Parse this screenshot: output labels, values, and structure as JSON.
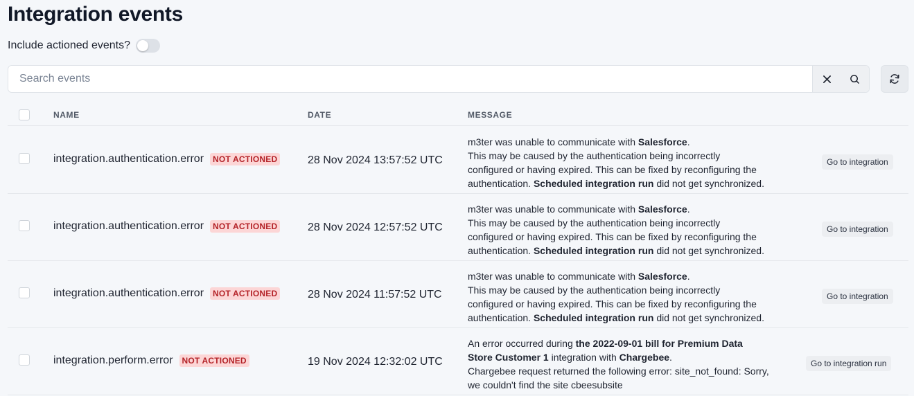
{
  "page": {
    "title": "Integration events"
  },
  "filter": {
    "include_actioned_label": "Include actioned events?",
    "include_actioned": false
  },
  "search": {
    "placeholder": "Search events",
    "value": ""
  },
  "table": {
    "headers": {
      "name": "NAME",
      "date": "DATE",
      "message": "MESSAGE"
    },
    "rows": [
      {
        "name": "integration.authentication.error",
        "status": "NOT ACTIONED",
        "date": "28 Nov 2024 13:57:52 UTC",
        "message": {
          "l1a": "m3ter was unable to communicate with ",
          "l1b": "Salesforce",
          "l1c": ".",
          "l2": "This may be caused by the authentication being incorrectly",
          "l3": "configured or having expired. This can be fixed by reconfiguring the",
          "l4a": "authentication. ",
          "l4b": "Scheduled integration run",
          "l4c": " did not get synchronized."
        },
        "action": "Go to integration"
      },
      {
        "name": "integration.authentication.error",
        "status": "NOT ACTIONED",
        "date": "28 Nov 2024 12:57:52 UTC",
        "message": {
          "l1a": "m3ter was unable to communicate with ",
          "l1b": "Salesforce",
          "l1c": ".",
          "l2": "This may be caused by the authentication being incorrectly",
          "l3": "configured or having expired. This can be fixed by reconfiguring the",
          "l4a": "authentication. ",
          "l4b": "Scheduled integration run",
          "l4c": " did not get synchronized."
        },
        "action": "Go to integration"
      },
      {
        "name": "integration.authentication.error",
        "status": "NOT ACTIONED",
        "date": "28 Nov 2024 11:57:52 UTC",
        "message": {
          "l1a": "m3ter was unable to communicate with ",
          "l1b": "Salesforce",
          "l1c": ".",
          "l2": "This may be caused by the authentication being incorrectly",
          "l3": "configured or having expired. This can be fixed by reconfiguring the",
          "l4a": "authentication. ",
          "l4b": "Scheduled integration run",
          "l4c": " did not get synchronized."
        },
        "action": "Go to integration"
      },
      {
        "name": "integration.perform.error",
        "status": "NOT ACTIONED",
        "date": "19 Nov 2024 12:32:02 UTC",
        "message": {
          "l1a": "An error occurred during ",
          "l1b": "the 2022-09-01 bill for Premium Data",
          "l2a": "Store Customer 1",
          "l2b": " integration with ",
          "l2c": "Chargebee",
          "l2d": ".",
          "l3": "Chargebee request returned the following error: site_not_found: Sorry,",
          "l4": "we couldn't find the site cbeesubsite"
        },
        "action": "Go to integration run"
      }
    ]
  },
  "icons": {
    "clear": "close-icon",
    "search": "search-icon",
    "refresh": "refresh-icon"
  }
}
